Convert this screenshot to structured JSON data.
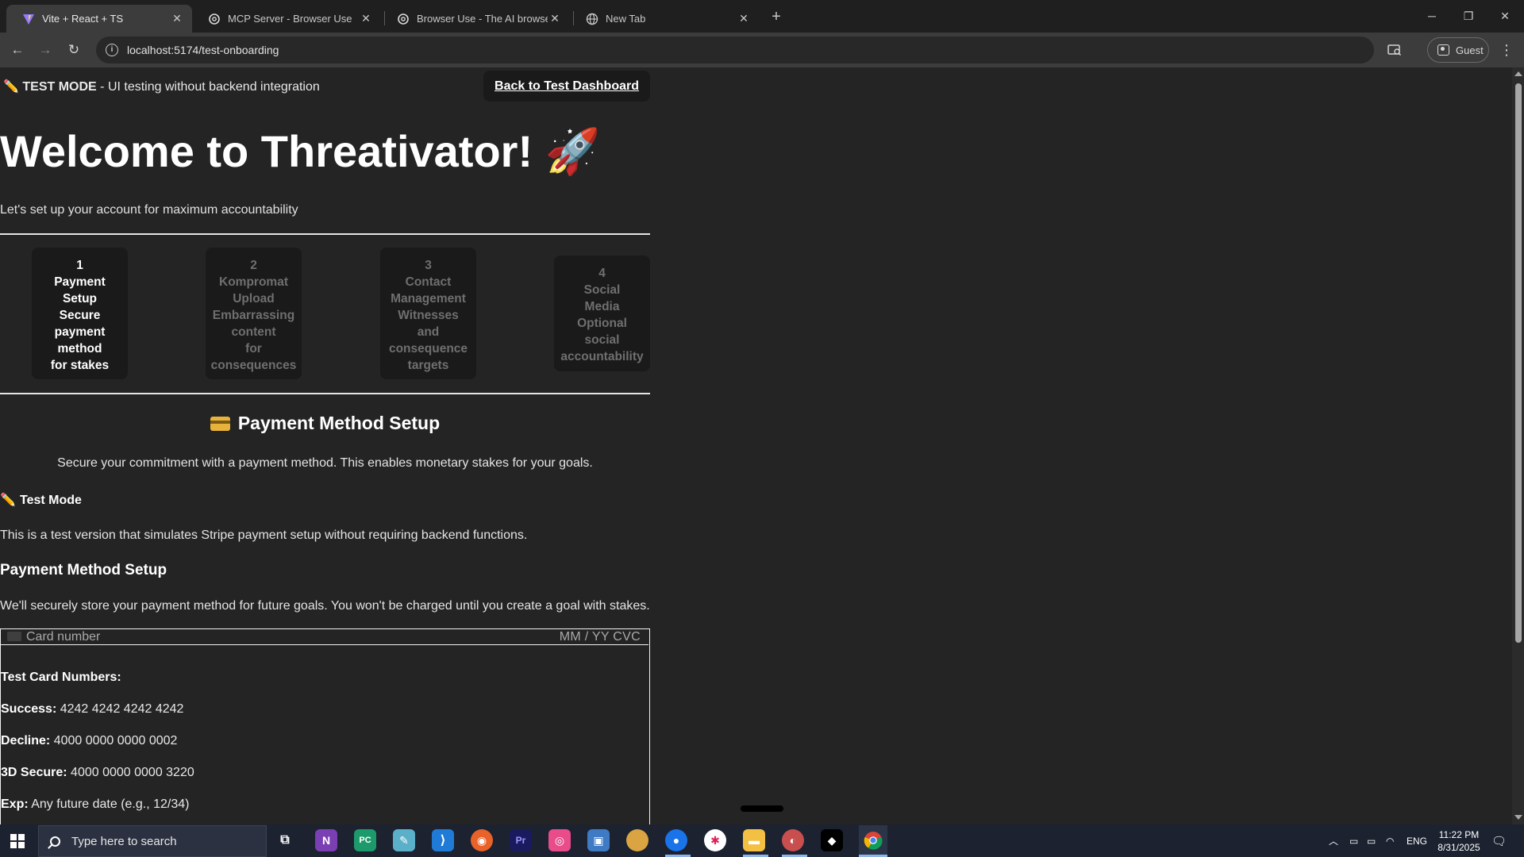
{
  "browser": {
    "tabs": [
      {
        "title": "Vite + React + TS",
        "active": true
      },
      {
        "title": "MCP Server - Browser Use",
        "active": false
      },
      {
        "title": "Browser Use - The AI browser a",
        "active": false
      },
      {
        "title": "New Tab",
        "active": false
      }
    ],
    "url": "localhost:5174/test-onboarding",
    "profile_label": "Guest"
  },
  "page": {
    "test_mode_label": "TEST MODE",
    "test_mode_text": " - UI testing without backend integration",
    "back_button": "Back to Test Dashboard",
    "title": "Welcome to Threativator! 🚀",
    "subtitle": "Let's set up your account for maximum accountability",
    "steps": [
      {
        "number": "1",
        "lines": [
          "Payment",
          "Setup",
          "Secure",
          "payment",
          "method",
          "for stakes"
        ],
        "active": true
      },
      {
        "number": "2",
        "lines": [
          "Kompromat",
          "Upload",
          "Embarrassing",
          "content",
          "for",
          "consequences"
        ],
        "active": false
      },
      {
        "number": "3",
        "lines": [
          "Contact",
          "Management",
          "Witnesses",
          "and",
          "consequence",
          "targets"
        ],
        "active": false
      },
      {
        "number": "4",
        "lines": [
          "Social",
          "Media",
          "Optional",
          "social",
          "accountability"
        ],
        "active": false
      }
    ],
    "section_title": "Payment Method Setup",
    "section_desc": "Secure your commitment with a payment method. This enables monetary stakes for your goals.",
    "test_mode_heading": "Test Mode",
    "test_mode_desc": "This is a test version that simulates Stripe payment setup without requiring backend functions.",
    "payment_heading": "Payment Method Setup",
    "payment_desc": "We'll securely store your payment method for future goals. You won't be charged until you create a goal with stakes.",
    "card_input": {
      "placeholder": "Card number",
      "exp_cvc": "MM / YY  CVC"
    },
    "test_cards_heading": "Test Card Numbers:",
    "test_cards": [
      {
        "label": "Success:",
        "value": " 4242 4242 4242 4242"
      },
      {
        "label": "Decline:",
        "value": " 4000 0000 0000 0002"
      },
      {
        "label": "3D Secure:",
        "value": " 4000 0000 0000 3220"
      },
      {
        "label": "Exp:",
        "value": " Any future date (e.g., 12/34)"
      }
    ]
  },
  "taskbar": {
    "search_placeholder": "Type here to search",
    "language": "ENG",
    "time": "11:22 PM",
    "date": "8/31/2025"
  }
}
